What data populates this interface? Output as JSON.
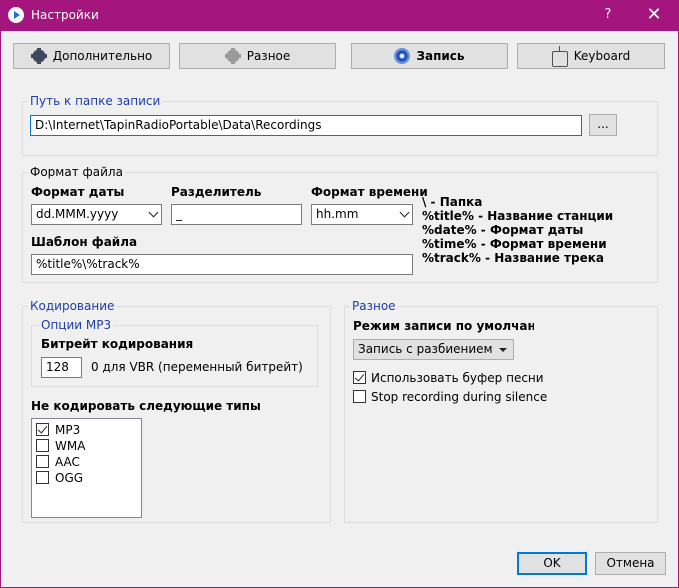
{
  "window": {
    "title": "Настройки",
    "help": "?",
    "close": "✕"
  },
  "tabs": [
    {
      "label": "Дополнительно",
      "icon": "gear-icon"
    },
    {
      "label": "Разное",
      "icon": "gear-icon"
    },
    {
      "label": "Запись",
      "icon": "record-icon",
      "active": true
    },
    {
      "label": "Keyboard",
      "icon": "keyboard-icon"
    }
  ],
  "path_group": {
    "legend": "Путь к папке записи",
    "value": "D:\\Internet\\TapinRadioPortable\\Data\\Recordings",
    "browse": "..."
  },
  "format_group": {
    "legend": "Формат файла",
    "date_label": "Формат даты",
    "date_value": "dd.MMM.yyyy",
    "sep_label": "Разделитель",
    "sep_value": "_",
    "time_label": "Формат времени",
    "time_value": "hh.mm",
    "template_label": "Шаблон файла",
    "template_value": "%title%\\%track%",
    "help": [
      "\\ - Папка",
      "%title% - Название станции",
      "%date% - Формат даты",
      "%time% - Формат времени",
      "%track% - Название трека"
    ]
  },
  "encoding_group": {
    "legend": "Кодирование",
    "mp3_legend": "Опции MP3",
    "bitrate_label": "Битрейт кодирования",
    "bitrate_value": "128",
    "bitrate_hint": "0 для VBR (переменный битрейт)",
    "no_encode_label": "Не кодировать следующие типы",
    "types": [
      {
        "label": "MP3",
        "checked": true
      },
      {
        "label": "WMA",
        "checked": false
      },
      {
        "label": "AAC",
        "checked": false
      },
      {
        "label": "OGG",
        "checked": false
      }
    ]
  },
  "misc_group": {
    "legend": "Разное",
    "mode_label": "Режим записи по умолчанию",
    "mode_value": "Запись с разбиением",
    "song_buffer": {
      "label": "Использовать буфер песни",
      "checked": true
    },
    "stop_silence": {
      "label": "Stop recording during silence",
      "checked": false
    }
  },
  "buttons": {
    "ok": "OK",
    "cancel": "Отмена"
  }
}
